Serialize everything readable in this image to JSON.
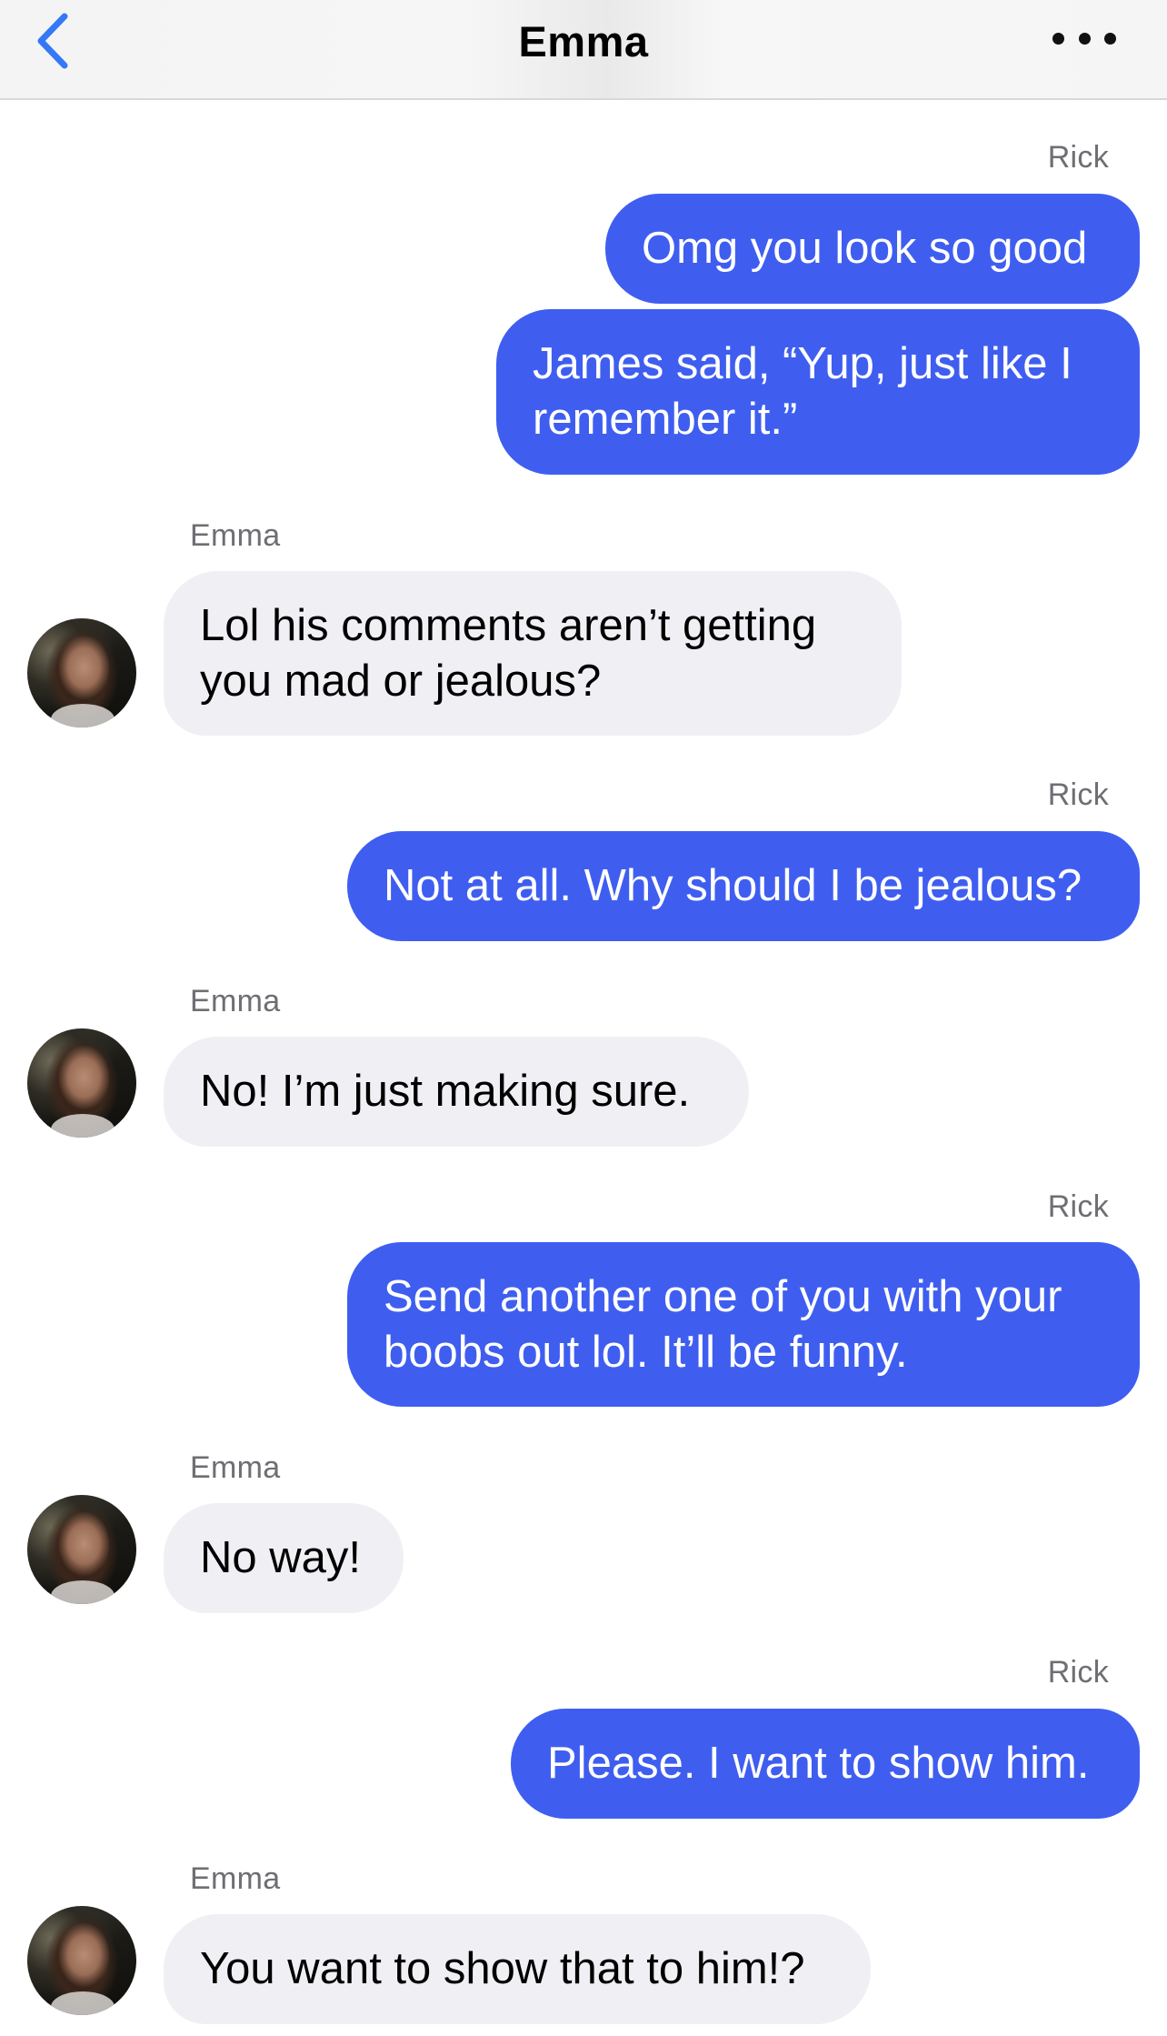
{
  "header": {
    "title": "Emma",
    "back_icon": "chevron-left-icon",
    "more_icon": "ellipsis-icon",
    "accent_color": "#3478f6"
  },
  "colors": {
    "outgoing_bubble": "#3f5ef0",
    "incoming_bubble": "#f0f0f4",
    "sender_label": "#6e6e73"
  },
  "messages": [
    {
      "sender": "Rick",
      "text": "Omg you look so good"
    },
    {
      "text": "James said, “Yup, just like I remember it.”"
    },
    {
      "sender": "Emma",
      "text": "Lol his comments aren’t getting you mad or jealous?"
    },
    {
      "sender": "Rick",
      "text": "Not at all. Why should I be jealous?"
    },
    {
      "sender": "Emma",
      "text": "No! I’m just making sure."
    },
    {
      "sender": "Rick",
      "text": "Send another one of you with your boobs out lol. It’ll be funny."
    },
    {
      "sender": "Emma",
      "text": "No way!"
    },
    {
      "sender": "Rick",
      "text": "Please. I want to show him."
    },
    {
      "sender": "Emma",
      "text": "You want to show that to him!?"
    }
  ]
}
